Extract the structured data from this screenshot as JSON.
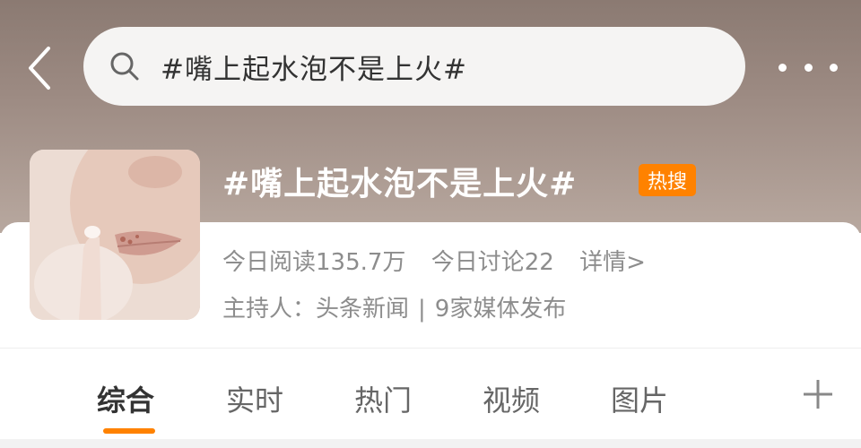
{
  "search": {
    "query": "#嘴上起水泡不是上火#"
  },
  "topic": {
    "title": "#嘴上起水泡不是上火#",
    "badge": "热搜",
    "reads": "今日阅读135.7万",
    "discussions": "今日讨论22",
    "details": "详情>",
    "host_label": "主持人：头条新闻",
    "separator": "|",
    "media": "9家媒体发布"
  },
  "tabs": [
    {
      "label": "综合",
      "active": true
    },
    {
      "label": "实时"
    },
    {
      "label": "热门"
    },
    {
      "label": "视频"
    },
    {
      "label": "图片"
    }
  ],
  "icons": {
    "back": "chevron-left-icon",
    "search": "search-icon",
    "more": "more-dots-icon",
    "add": "plus-icon"
  },
  "colors": {
    "accent": "#ff8200",
    "badge": "#ff8200"
  }
}
